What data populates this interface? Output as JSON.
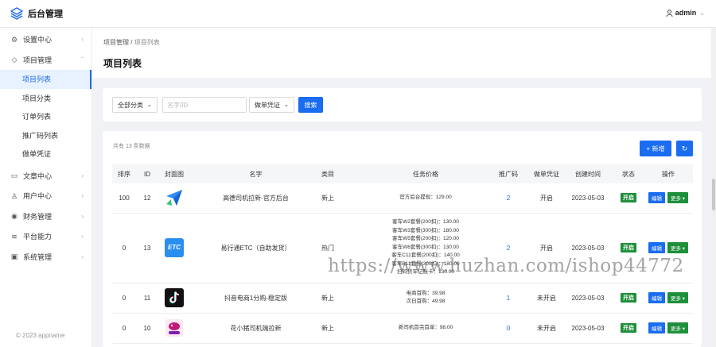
{
  "app": {
    "title": "后台管理",
    "user": "admin"
  },
  "sidebar": {
    "menus": [
      {
        "label": "设置中心",
        "icon": "settings-icon"
      },
      {
        "label": "项目管理",
        "icon": "box-icon"
      }
    ],
    "subitems": [
      "项目列表",
      "项目分类",
      "订单列表",
      "推广码列表",
      "做单凭证"
    ],
    "menus2": [
      {
        "label": "文章中心",
        "icon": "book-icon"
      },
      {
        "label": "用户中心",
        "icon": "user-icon"
      },
      {
        "label": "财务管理",
        "icon": "money-icon"
      },
      {
        "label": "平台能力",
        "icon": "layers-icon"
      },
      {
        "label": "系统管理",
        "icon": "monitor-icon"
      }
    ],
    "copyright": "© 2023 appname"
  },
  "page": {
    "breadcrumb_root": "项目管理",
    "breadcrumb_sep": "/",
    "breadcrumb_current": "项目列表",
    "title": "项目列表"
  },
  "filter": {
    "category": "全部分类",
    "search_placeholder": "名字/ID",
    "proof": "做单凭证",
    "search_label": "搜索"
  },
  "list": {
    "total": "共有 13 条数据",
    "new_label": "+ 新增",
    "columns": [
      "排序",
      "ID",
      "封面图",
      "名字",
      "类目",
      "任务价格",
      "推广码",
      "做单凭证",
      "创建时间",
      "状态",
      "操作"
    ],
    "rows": [
      {
        "sort": "100",
        "id": "12",
        "name": "高德司机拉新-官方后台",
        "category": "新上",
        "price": [
          "官方后台提现：129.00"
        ],
        "code": "2",
        "proof": "开启",
        "date": "2023-05-03",
        "status": "开启"
      },
      {
        "sort": "0",
        "id": "13",
        "name": "易行通ETC（自助发货）",
        "category": "热门",
        "price": [
          "客车W2套餐(200扣)：130.00",
          "客车W3套餐(300扣)：180.00",
          "客车W5套餐(200扣)：120.00",
          "客车W6套餐(300扣)：130.00",
          "客车C11套餐(200扣)：140.00",
          "客车B11套餐(300扣)：180.00",
          "扫码货车记账卡：130.00"
        ],
        "code": "2",
        "proof": "开启",
        "date": "2023-05-03",
        "status": "开启"
      },
      {
        "sort": "0",
        "id": "11",
        "name": "抖音电商1分购-稳定版",
        "category": "新上",
        "price": [
          "电商首购：39.98",
          "次日首购：49.98"
        ],
        "code": "1",
        "proof": "未开启",
        "date": "2023-05-03",
        "status": "开启"
      },
      {
        "sort": "0",
        "id": "10",
        "name": "花小猪司机端拉新",
        "category": "新上",
        "price": [
          "新司机首完首单：98.00"
        ],
        "code": "0",
        "proof": "未开启",
        "date": "2023-05-03",
        "status": "开启"
      }
    ],
    "edit_label": "编辑",
    "more_label": "更多",
    "cover_etc_text": "ETC"
  },
  "watermark": "https://www.huzhan.com/ishop44772",
  "colors": {
    "primary": "#1a6cf0",
    "success": "#1e8f3a"
  }
}
